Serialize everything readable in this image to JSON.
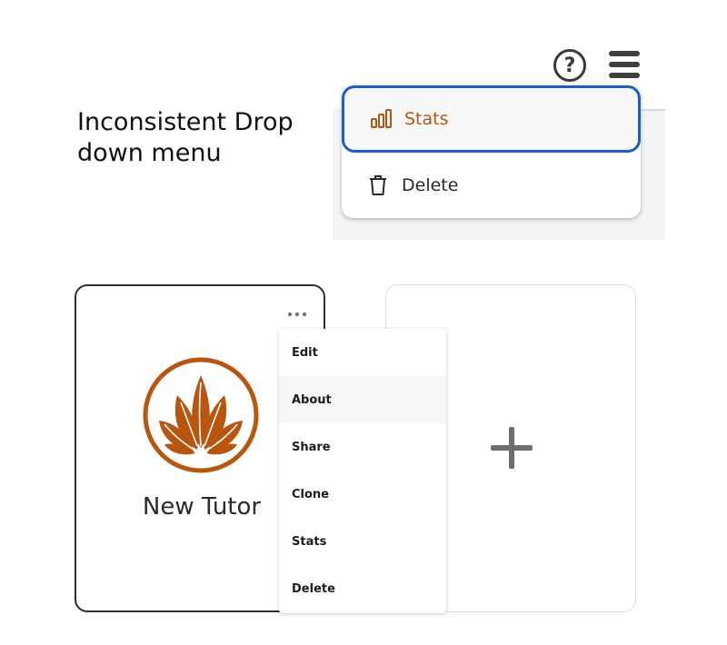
{
  "caption": "Inconsistent Drop\ndown menu",
  "header": {
    "help_icon": "help-circle-icon",
    "menu_icon": "hamburger-menu-icon",
    "help_glyph": "?"
  },
  "top_dropdown": {
    "items": [
      {
        "label": "Stats",
        "icon": "bar-chart-icon",
        "selected": true
      },
      {
        "label": "Delete",
        "icon": "trash-icon",
        "selected": false
      }
    ],
    "accent_color": "#b3560f",
    "focus_border_color": "#1b5fc1"
  },
  "tutor_card": {
    "name": "New Tutor",
    "logo_icon": "lotus-leaf-icon",
    "more_icon": "more-horizontal-icon",
    "logo_color": "#b8560f"
  },
  "context_menu": {
    "items": [
      {
        "label": "Edit"
      },
      {
        "label": "About"
      },
      {
        "label": "Share"
      },
      {
        "label": "Clone"
      },
      {
        "label": "Stats"
      },
      {
        "label": "Delete"
      }
    ]
  },
  "add_card": {
    "icon": "plus-icon"
  }
}
